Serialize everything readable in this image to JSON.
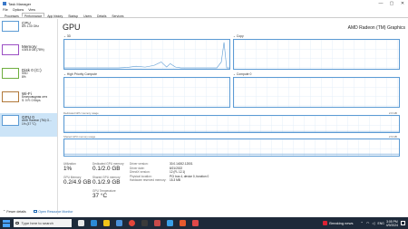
{
  "window": {
    "title": "Task Manager",
    "minimize": "—",
    "maximize": "▢",
    "close": "✕"
  },
  "menu": [
    "File",
    "Options",
    "View"
  ],
  "tabs": [
    "Processes",
    "Performance",
    "App history",
    "Startup",
    "Users",
    "Details",
    "Services"
  ],
  "sidebar": [
    {
      "name": "CPU",
      "sub1": "8% 1.00 GHz",
      "sub2": ""
    },
    {
      "name": "Memory",
      "sub1": "4.5/5.8 GB (78%)",
      "sub2": ""
    },
    {
      "name": "Disk 0 (C:)",
      "sub1": "SSD",
      "sub2": "8%"
    },
    {
      "name": "Wi-Fi",
      "sub1": "Беспроводная сеть",
      "sub2": "S: 0 R: 0 Kbps"
    },
    {
      "name": "GPU 0",
      "sub1": "AMD Radeon (TM) G...",
      "sub2": "1% (37 °C)"
    }
  ],
  "main": {
    "title": "GPU",
    "gpu_name": "AMD Radeon (TM) Graphics",
    "engines": [
      {
        "label": "3D",
        "pct": ""
      },
      {
        "label": "Copy",
        "pct": ""
      },
      {
        "label": "High Priority Compute",
        "pct": ""
      },
      {
        "label": "Compute 0",
        "pct": ""
      }
    ],
    "dedicated_label": "Dedicated GPU memory usage",
    "dedicated_max": "2.0 GB",
    "shared_label": "Shared GPU memory usage",
    "shared_max": "2.9 GB"
  },
  "stats": {
    "utilization": {
      "label": "Utilization",
      "value": "1%"
    },
    "dedicated": {
      "label": "Dedicated GPU memory",
      "value": "0.1/2.0 GB"
    },
    "gpu_memory": {
      "label": "GPU Memory",
      "value": "0.2/4.9 GB"
    },
    "shared": {
      "label": "Shared GPU memory",
      "value": "0.1/2.9 GB"
    },
    "temperature": {
      "label": "GPU Temperature",
      "value": "37 °C"
    }
  },
  "properties": [
    {
      "k": "Driver version:",
      "v": "30.0.14002.12001"
    },
    {
      "k": "Driver date:",
      "v": "8/21/2022"
    },
    {
      "k": "DirectX version:",
      "v": "12 (FL 12.1)"
    },
    {
      "k": "Physical location:",
      "v": "PCI bus 4, device 0, function 0"
    },
    {
      "k": "Hardware reserved memory:",
      "v": "15.3 MB"
    }
  ],
  "footer": {
    "fewer_details": "Fewer details",
    "open_monitor": "Open Resource Monitor"
  },
  "taskbar": {
    "search_placeholder": "Type here to search",
    "news": "Breaking news",
    "lang": "ENG",
    "time": "3:05 PM",
    "date": "4/9/2024"
  },
  "colors": {
    "accent": "#5c9bd4",
    "taskbar": "#1e2a3a",
    "selected": "#cce4f7"
  }
}
